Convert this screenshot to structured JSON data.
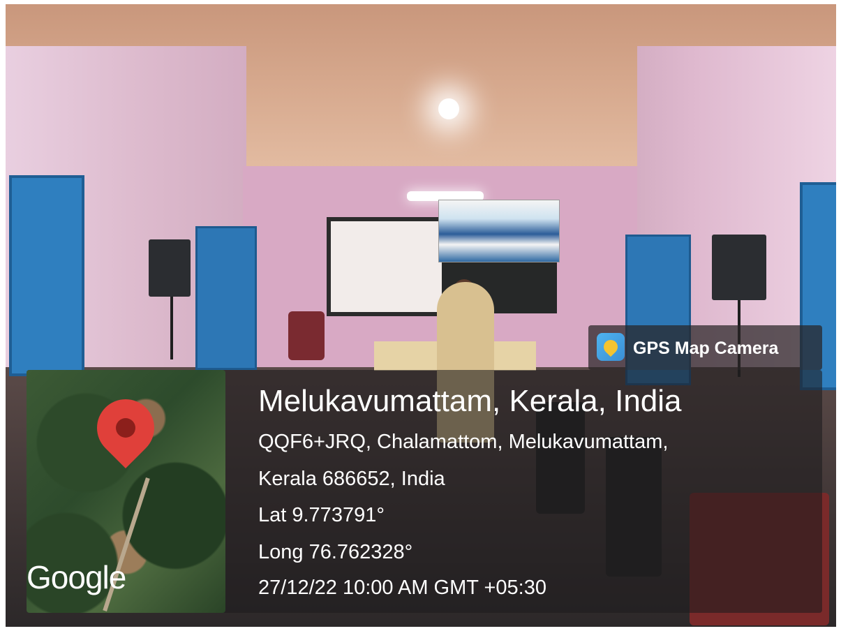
{
  "app": {
    "name": "GPS Map Camera",
    "icon": "gps-camera-app-icon"
  },
  "map": {
    "provider_logo": "Google",
    "pin_icon": "location-pin-icon",
    "pin_color": "#e0403a"
  },
  "location": {
    "title": "Melukavumattam, Kerala, India",
    "address_line1": "QQF6+JRQ, Chalamattom, Melukavumattam,",
    "address_line2": "Kerala 686652, India",
    "latitude": "Lat 9.773791°",
    "longitude": "Long 76.762328°",
    "timestamp": "27/12/22 10:00 AM GMT +05:30"
  }
}
